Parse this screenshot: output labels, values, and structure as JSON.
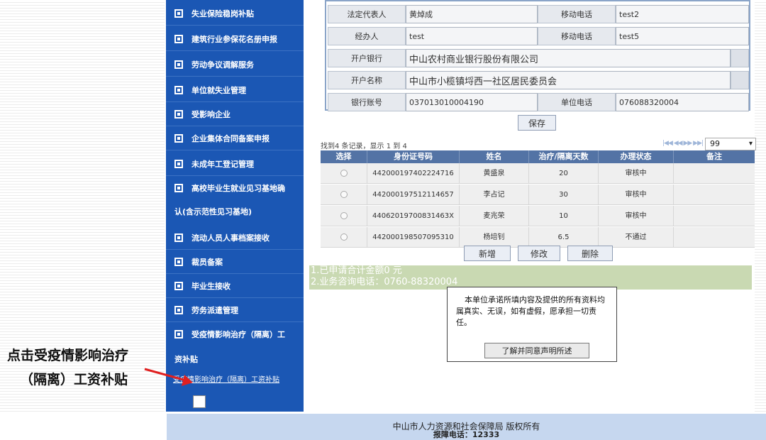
{
  "sidebar": {
    "items": [
      {
        "label": "失业保险稳岗补贴"
      },
      {
        "label": "建筑行业参保花名册申报"
      },
      {
        "label": "劳动争议调解服务"
      },
      {
        "label": "单位就失业管理"
      },
      {
        "label": "受影响企业"
      },
      {
        "label": "企业集体合同备案申报"
      },
      {
        "label": "未成年工登记管理"
      },
      {
        "label": "高校毕业生就业见习基地确"
      },
      {
        "label": "流动人员人事档案接收"
      },
      {
        "label": "裁员备案"
      },
      {
        "label": "毕业生接收"
      },
      {
        "label": "劳务派遣管理"
      },
      {
        "label": "受疫情影响治疗（隔离）工"
      }
    ],
    "wrap_gaoxiao": "认(含示范性见习基地)",
    "wrap_yiqing": "资补贴",
    "sub_link": "受疫情影响治疗（隔离）工资补贴"
  },
  "form": {
    "rows": [
      {
        "l1": "法定代表人",
        "v1": "黄焯成",
        "l2": "移动电话",
        "v2": "test2"
      },
      {
        "l1": "经办人",
        "v1": "test",
        "l2": "移动电话",
        "v2": "test5"
      },
      {
        "l1": "开户银行",
        "v1": "中山农村商业银行股份有限公司"
      },
      {
        "l1": "开户名称",
        "v1": "中山市小榄镇埒西一社区居民委员会"
      },
      {
        "l1": "银行账号",
        "v1": "037013010004190",
        "l2": "单位电话",
        "v2": "076088320004"
      }
    ],
    "save_label": "保存"
  },
  "list": {
    "info": "找到4 条记录，显示 1 到 4",
    "page_size": "99",
    "columns": [
      "选择",
      "身份证号码",
      "姓名",
      "治疗/隔离天数",
      "办理状态",
      "备注"
    ],
    "rows": [
      {
        "id": "442000197402224716",
        "name": "黄盛泉",
        "days": "20",
        "status": "审核中",
        "note": ""
      },
      {
        "id": "442000197512114657",
        "name": "李占记",
        "days": "30",
        "status": "审核中",
        "note": ""
      },
      {
        "id": "44062019700831463X",
        "name": "麦兆荣",
        "days": "10",
        "status": "审核中",
        "note": ""
      },
      {
        "id": "442000198507095310",
        "name": "杨培钊",
        "days": "6.5",
        "status": "不通过",
        "note": ""
      }
    ],
    "add_label": "新增",
    "edit_label": "修改",
    "delete_label": "删除"
  },
  "notice": {
    "line1": "1.已申请合计金额0 元",
    "line2": "2.业务咨询电话：0760-88320004"
  },
  "modal": {
    "text1": "本单位承诺所填内容及提供的所有资料均",
    "text2": "属真实、无误，如有虚假，愿承担一切责",
    "text3": "任。",
    "button": "了解并同意声明所述"
  },
  "footer": {
    "line1": "中山市人力资源和社会保障局 版权所有",
    "line2": "报障电话：12333"
  },
  "annotation": {
    "line1": "点击受疫情影响治疗",
    "line2": "（隔离）工资补贴"
  },
  "colors": {
    "sidebar": "#1b57b4",
    "arrow": "#e02020",
    "grid_header": "#5373a5"
  }
}
